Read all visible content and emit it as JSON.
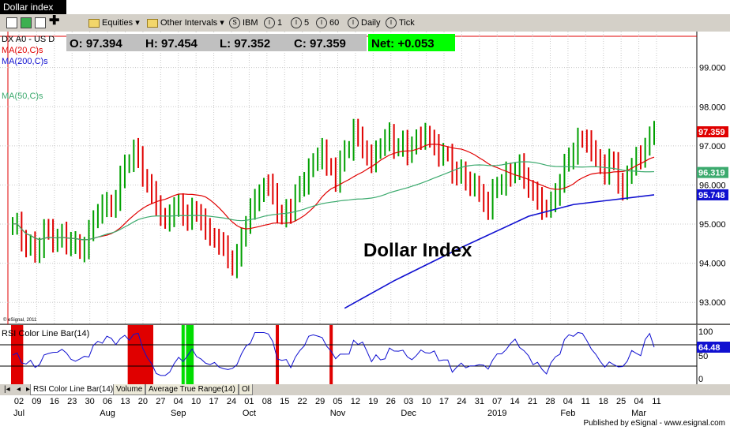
{
  "window": {
    "title": "Dollar index"
  },
  "toolbar": {
    "items": [
      {
        "label": "Equities",
        "icon": "folder-icon",
        "dropdown": true
      },
      {
        "label": "Other Intervals",
        "icon": "folder-icon",
        "dropdown": true
      },
      {
        "label": "IBM",
        "icon": "S"
      },
      {
        "label": "1",
        "icon": "I"
      },
      {
        "label": "5",
        "icon": "I"
      },
      {
        "label": "60",
        "icon": "I"
      },
      {
        "label": "Daily",
        "icon": "I"
      },
      {
        "label": "Tick",
        "icon": "I"
      }
    ]
  },
  "quote": {
    "o": "O: 97.394",
    "h": "H: 97.454",
    "l": "L: 97.352",
    "c": "C: 97.359",
    "net": "Net: +0.053"
  },
  "legend": {
    "symbol": "DX A0 - US D",
    "ma20": "MA(20,C)s",
    "ma200": "MA(200,C)s",
    "ma50": "MA(50,C)s",
    "copyright": "© eSignal, 2011"
  },
  "annotation": "Dollar Index",
  "price_tags": {
    "last": "97.359",
    "ma50": "96.319",
    "ma200": "95.748"
  },
  "rsi": {
    "label": "RSI Color Line Bar(14)",
    "value": "64.48",
    "levels": [
      70,
      30
    ],
    "axis_labels": [
      "100",
      "50",
      "0"
    ]
  },
  "tabs": [
    "RSI Color Line Bar(14)",
    "Volume",
    "Average True Range(14)",
    "Ol"
  ],
  "footer": "Published by eSignal - www.esignal.com",
  "colors": {
    "up_bar": "#00a000",
    "down_bar": "#e00000",
    "ma20": "#e00000",
    "ma50": "#3caa6e",
    "ma200": "#1010d0",
    "rsi_line": "#1010d0"
  },
  "chart_data": {
    "type": "ohlc",
    "title": "",
    "y_ticks": [
      93.0,
      94.0,
      95.0,
      96.0,
      97.0,
      98.0,
      99.0
    ],
    "y_tick_labels": [
      "93.000",
      "94.000",
      "95.000",
      "96.000",
      "97.000",
      "98.000",
      "99.000"
    ],
    "ylim": [
      92.5,
      99.8
    ],
    "x_labels": [
      {
        "day": "02",
        "month": "Jul"
      },
      {
        "day": "09",
        "month": ""
      },
      {
        "day": "16",
        "month": ""
      },
      {
        "day": "23",
        "month": ""
      },
      {
        "day": "30",
        "month": ""
      },
      {
        "day": "06",
        "month": "Aug"
      },
      {
        "day": "13",
        "month": ""
      },
      {
        "day": "20",
        "month": ""
      },
      {
        "day": "27",
        "month": ""
      },
      {
        "day": "04",
        "month": "Sep"
      },
      {
        "day": "10",
        "month": ""
      },
      {
        "day": "17",
        "month": ""
      },
      {
        "day": "24",
        "month": ""
      },
      {
        "day": "01",
        "month": "Oct"
      },
      {
        "day": "08",
        "month": ""
      },
      {
        "day": "15",
        "month": ""
      },
      {
        "day": "22",
        "month": ""
      },
      {
        "day": "29",
        "month": ""
      },
      {
        "day": "05",
        "month": "Nov"
      },
      {
        "day": "12",
        "month": ""
      },
      {
        "day": "19",
        "month": ""
      },
      {
        "day": "26",
        "month": ""
      },
      {
        "day": "03",
        "month": "Dec"
      },
      {
        "day": "10",
        "month": ""
      },
      {
        "day": "17",
        "month": ""
      },
      {
        "day": "24",
        "month": ""
      },
      {
        "day": "31",
        "month": ""
      },
      {
        "day": "07",
        "month": "2019"
      },
      {
        "day": "14",
        "month": ""
      },
      {
        "day": "21",
        "month": ""
      },
      {
        "day": "28",
        "month": ""
      },
      {
        "day": "04",
        "month": "Feb"
      },
      {
        "day": "11",
        "month": ""
      },
      {
        "day": "18",
        "month": ""
      },
      {
        "day": "25",
        "month": ""
      },
      {
        "day": "04",
        "month": "Mar"
      },
      {
        "day": "11",
        "month": ""
      }
    ],
    "close_anchors": [
      [
        0,
        95.0
      ],
      [
        3,
        94.4
      ],
      [
        5,
        94.3
      ],
      [
        7,
        94.9
      ],
      [
        10,
        94.6
      ],
      [
        13,
        94.5
      ],
      [
        16,
        94.4
      ],
      [
        19,
        95.3
      ],
      [
        22,
        95.4
      ],
      [
        25,
        96.5
      ],
      [
        27,
        96.9
      ],
      [
        30,
        96.0
      ],
      [
        32,
        95.5
      ],
      [
        34,
        95.1
      ],
      [
        36,
        95.4
      ],
      [
        38,
        95.2
      ],
      [
        40,
        95.4
      ],
      [
        42,
        95.1
      ],
      [
        44,
        94.7
      ],
      [
        46,
        94.5
      ],
      [
        48,
        94.1
      ],
      [
        50,
        94.2
      ],
      [
        52,
        95.0
      ],
      [
        54,
        95.6
      ],
      [
        56,
        96.0
      ],
      [
        58,
        95.8
      ],
      [
        60,
        95.2
      ],
      [
        62,
        95.3
      ],
      [
        64,
        96.0
      ],
      [
        66,
        96.4
      ],
      [
        68,
        96.7
      ],
      [
        69,
        96.9
      ],
      [
        70,
        96.5
      ],
      [
        72,
        96.1
      ],
      [
        74,
        96.9
      ],
      [
        76,
        97.4
      ],
      [
        78,
        96.9
      ],
      [
        80,
        96.6
      ],
      [
        82,
        97.0
      ],
      [
        84,
        97.3
      ],
      [
        86,
        97.0
      ],
      [
        88,
        96.8
      ],
      [
        90,
        97.2
      ],
      [
        92,
        97.3
      ],
      [
        94,
        97.0
      ],
      [
        96,
        96.8
      ],
      [
        98,
        96.3
      ],
      [
        100,
        96.4
      ],
      [
        102,
        96.0
      ],
      [
        104,
        95.8
      ],
      [
        106,
        95.4
      ],
      [
        108,
        96.0
      ],
      [
        110,
        96.3
      ],
      [
        112,
        96.4
      ],
      [
        114,
        96.2
      ],
      [
        116,
        95.8
      ],
      [
        118,
        95.4
      ],
      [
        120,
        95.6
      ],
      [
        122,
        96.0
      ],
      [
        124,
        96.7
      ],
      [
        126,
        97.2
      ],
      [
        128,
        97.1
      ],
      [
        130,
        96.7
      ],
      [
        132,
        96.3
      ],
      [
        134,
        96.6
      ],
      [
        136,
        95.9
      ],
      [
        138,
        96.5
      ],
      [
        140,
        96.7
      ],
      [
        142,
        97.3
      ],
      [
        143,
        97.359
      ]
    ],
    "series": [
      {
        "name": "MA(20,C)s",
        "type": "moving_average",
        "period": 20
      },
      {
        "name": "MA(50,C)s",
        "type": "moving_average",
        "period": 50
      },
      {
        "name": "MA(200,C)s",
        "type": "moving_average",
        "period": 200,
        "points": [
          [
            74,
            92.85
          ],
          [
            85,
            93.55
          ],
          [
            100,
            94.4
          ],
          [
            115,
            95.2
          ],
          [
            125,
            95.5
          ],
          [
            143,
            95.748
          ]
        ]
      }
    ],
    "last": {
      "open": 97.394,
      "high": 97.454,
      "low": 97.352,
      "close": 97.359,
      "net": 0.053
    }
  }
}
